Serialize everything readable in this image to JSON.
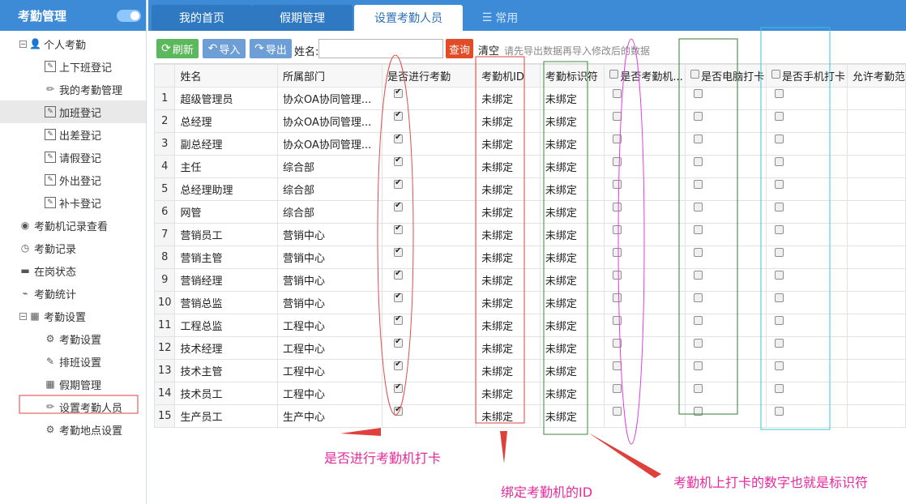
{
  "sidebar": {
    "title": "考勤管理",
    "items": [
      {
        "label": "个人考勤",
        "icon": "user-icon",
        "level": 0,
        "expander": "−"
      },
      {
        "label": "上下班登记",
        "icon": "edit-icon",
        "level": 1
      },
      {
        "label": "我的考勤管理",
        "icon": "pencil-icon",
        "level": 1
      },
      {
        "label": "加班登记",
        "icon": "edit-icon",
        "level": 1,
        "selected": true
      },
      {
        "label": "出差登记",
        "icon": "edit-icon",
        "level": 1
      },
      {
        "label": "请假登记",
        "icon": "edit-icon",
        "level": 1
      },
      {
        "label": "外出登记",
        "icon": "edit-icon",
        "level": 1
      },
      {
        "label": "补卡登记",
        "icon": "edit-icon",
        "level": 1
      },
      {
        "label": "考勤机记录查看",
        "icon": "eye-icon",
        "level": 0
      },
      {
        "label": "考勤记录",
        "icon": "clock-icon",
        "level": 0
      },
      {
        "label": "在岗状态",
        "icon": "card-icon",
        "level": 0
      },
      {
        "label": "考勤统计",
        "icon": "chart-icon",
        "level": 0
      },
      {
        "label": "考勤设置",
        "icon": "calendar-icon",
        "level": 0,
        "expander": "−"
      },
      {
        "label": "考勤设置",
        "icon": "gear-icon",
        "level": 1
      },
      {
        "label": "排班设置",
        "icon": "notepad-icon",
        "level": 1
      },
      {
        "label": "假期管理",
        "icon": "calendar-icon",
        "level": 1
      },
      {
        "label": "设置考勤人员",
        "icon": "pencil-icon",
        "level": 1
      },
      {
        "label": "考勤地点设置",
        "icon": "gear-icon",
        "level": 1
      }
    ]
  },
  "tabs": [
    {
      "label": "我的首页"
    },
    {
      "label": "假期管理"
    },
    {
      "label": "设置考勤人员"
    },
    {
      "label": "常用"
    }
  ],
  "toolbar": {
    "refresh": "刷新",
    "import": "导入",
    "export": "导出",
    "name_label": "姓名:",
    "name_value": "",
    "query": "查询",
    "clear": "清空",
    "hint": "请先导出数据再导入修改后的数据"
  },
  "table": {
    "columns": [
      "姓名",
      "所属部门",
      "是否进行考勤",
      "考勤机ID",
      "考勤标识符",
      "是否考勤机...",
      "是否电脑打卡",
      "是否手机打卡",
      "允许考勤范"
    ],
    "rows": [
      {
        "n": "1",
        "name": "超级管理员",
        "dept": "协众OA协同管理...",
        "att": true,
        "mid": "未绑定",
        "tag": "未绑定"
      },
      {
        "n": "2",
        "name": "总经理",
        "dept": "协众OA协同管理...",
        "att": true,
        "mid": "未绑定",
        "tag": "未绑定"
      },
      {
        "n": "3",
        "name": "副总经理",
        "dept": "协众OA协同管理...",
        "att": true,
        "mid": "未绑定",
        "tag": "未绑定"
      },
      {
        "n": "4",
        "name": "主任",
        "dept": "综合部",
        "att": true,
        "mid": "未绑定",
        "tag": "未绑定"
      },
      {
        "n": "5",
        "name": "总经理助理",
        "dept": "综合部",
        "att": true,
        "mid": "未绑定",
        "tag": "未绑定"
      },
      {
        "n": "6",
        "name": "网管",
        "dept": "综合部",
        "att": true,
        "mid": "未绑定",
        "tag": "未绑定"
      },
      {
        "n": "7",
        "name": "营销员工",
        "dept": "营销中心",
        "att": true,
        "mid": "未绑定",
        "tag": "未绑定"
      },
      {
        "n": "8",
        "name": "营销主管",
        "dept": "营销中心",
        "att": true,
        "mid": "未绑定",
        "tag": "未绑定"
      },
      {
        "n": "9",
        "name": "营销经理",
        "dept": "营销中心",
        "att": true,
        "mid": "未绑定",
        "tag": "未绑定"
      },
      {
        "n": "10",
        "name": "营销总监",
        "dept": "营销中心",
        "att": true,
        "mid": "未绑定",
        "tag": "未绑定"
      },
      {
        "n": "11",
        "name": "工程总监",
        "dept": "工程中心",
        "att": true,
        "mid": "未绑定",
        "tag": "未绑定"
      },
      {
        "n": "12",
        "name": "技术经理",
        "dept": "工程中心",
        "att": true,
        "mid": "未绑定",
        "tag": "未绑定"
      },
      {
        "n": "13",
        "name": "技术主管",
        "dept": "工程中心",
        "att": true,
        "mid": "未绑定",
        "tag": "未绑定"
      },
      {
        "n": "14",
        "name": "技术员工",
        "dept": "工程中心",
        "att": true,
        "mid": "未绑定",
        "tag": "未绑定"
      },
      {
        "n": "15",
        "name": "生产员工",
        "dept": "生产中心",
        "att": true,
        "mid": "未绑定",
        "tag": "未绑定"
      }
    ]
  },
  "annotations": {
    "a1": "是否进行考勤机打卡",
    "a2": "绑定考勤机的ID",
    "a3": "考勤机上打卡的数字也就是标识符",
    "a1_color": "#e6299b",
    "a2_color": "#e6299b",
    "a3_color": "#e6299b"
  }
}
